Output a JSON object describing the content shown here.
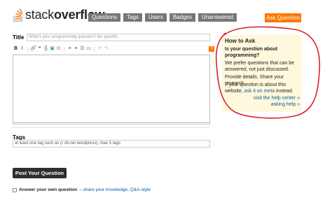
{
  "logo": {
    "light": "stack",
    "bold": "overflow"
  },
  "nav": {
    "items": [
      "Questions",
      "Tags",
      "Users",
      "Badges",
      "Unanswered"
    ],
    "ask_button": "Ask Question"
  },
  "form": {
    "title_label": "Title",
    "title_placeholder": "What's your programming question? Be specific.",
    "toolbar": [
      "B",
      "I",
      "🔗",
      "❝",
      "{}",
      "▣",
      "⊟",
      "≡",
      "≡",
      "☰",
      "▭",
      "↶",
      "↷"
    ],
    "help_button": "?",
    "tags_label": "Tags",
    "tags_placeholder": "at least one tag such as (r vb.net wordpress), max 5 tags",
    "post_button": "Post Your Question",
    "answer_own_label": "Answer your own question",
    "answer_own_link": "– share your knowledge, Q&A-style"
  },
  "how_to_ask": {
    "title": "How to Ask",
    "subtitle": "Is your question about programming?",
    "p1_a": "We prefer questions that can be ",
    "p1_em": "answered",
    "p1_b": ", not just discussed.",
    "p2": "Provide details. Share your research.",
    "p3_a": "If your question is about this website, ",
    "p3_link": "ask it on meta",
    "p3_b": " instead.",
    "link_help_center": "visit the help center »",
    "link_asking_help": "asking help »"
  },
  "colors": {
    "accent": "#ff7700",
    "nav_bg": "#777777",
    "link": "#0a5aa8",
    "sidebar_bg": "#fff8dc",
    "annotation": "#e0202a"
  }
}
